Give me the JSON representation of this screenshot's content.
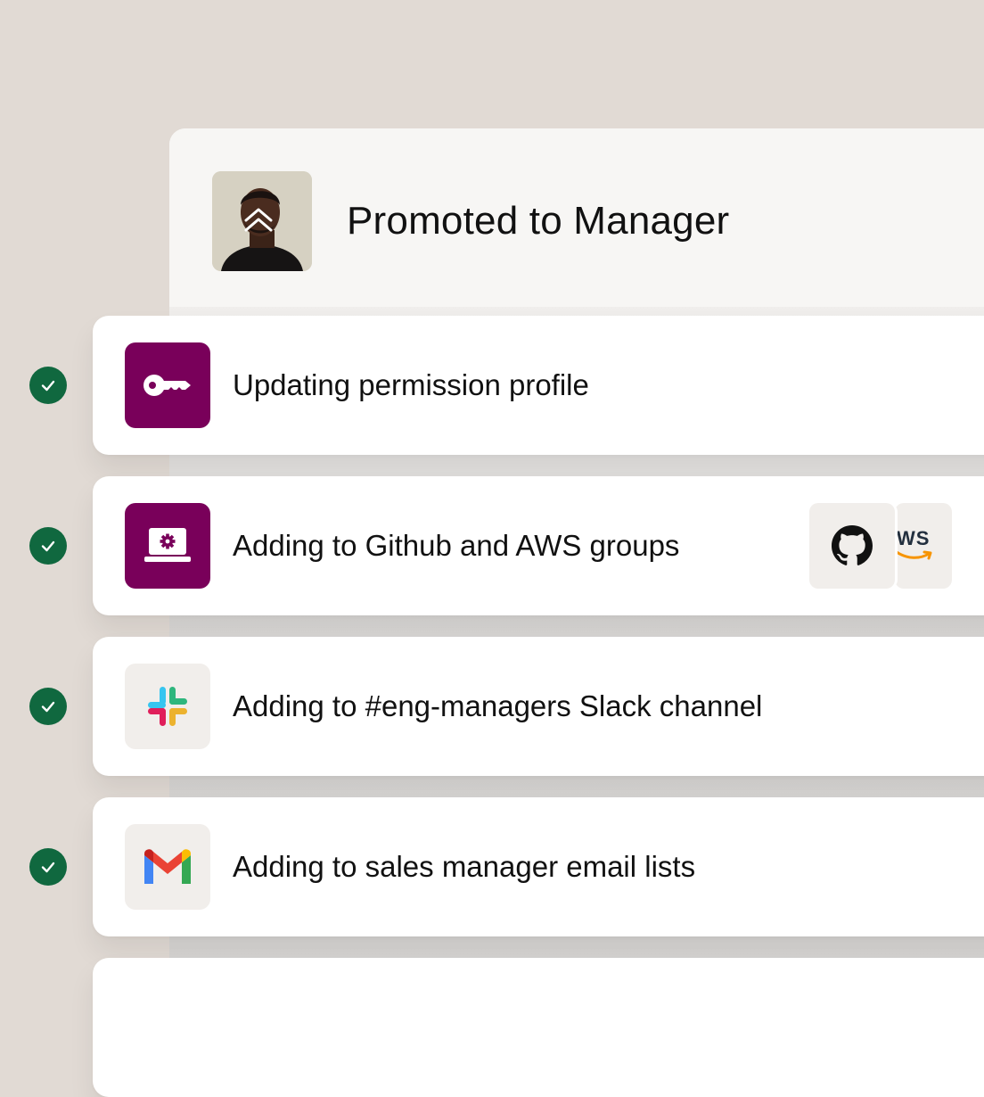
{
  "header": {
    "title": "Promoted to Manager",
    "avatar_icon": "double-chevron-up-icon"
  },
  "steps": [
    {
      "label": "Updating permission profile",
      "icon": "key-icon",
      "status": "completed"
    },
    {
      "label": "Adding to Github and AWS groups",
      "icon": "laptop-settings-icon",
      "status": "completed",
      "apps": [
        {
          "name": "github-icon"
        },
        {
          "name": "aws-icon",
          "text": "WS"
        }
      ]
    },
    {
      "label": "Adding to #eng-managers Slack channel",
      "icon": "slack-icon",
      "status": "completed"
    },
    {
      "label": "Adding to sales manager email lists",
      "icon": "gmail-icon",
      "status": "completed"
    }
  ],
  "colors": {
    "background": "#e1dad4",
    "accent_purple": "#79005a",
    "check_green": "#10683f"
  }
}
